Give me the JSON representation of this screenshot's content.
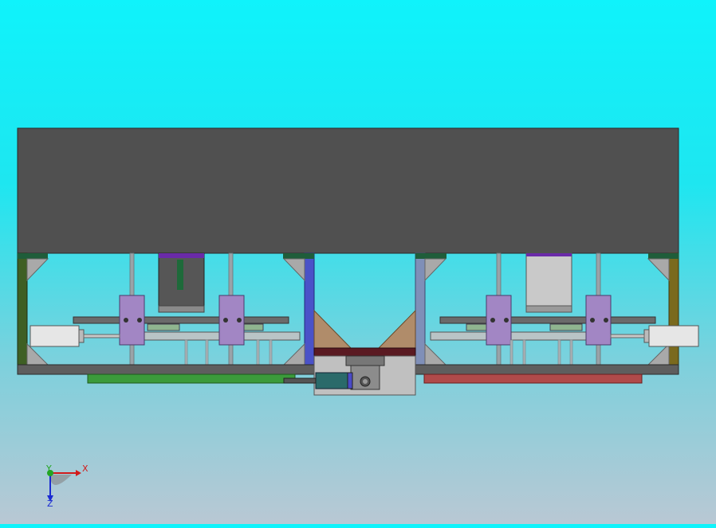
{
  "scene": {
    "background_top": "#0ff3fb",
    "background_bottom": "#b9c8d4",
    "model_top_plate_color": "#505050",
    "left_rail_color": "#3b9b3b",
    "right_rail_color": "#b04a4a"
  },
  "triad": {
    "x_label": "X",
    "y_label": "Y",
    "z_label": "Z",
    "x_color": "#d21a1a",
    "y_color": "#23a623",
    "z_color": "#1a2bd2"
  }
}
